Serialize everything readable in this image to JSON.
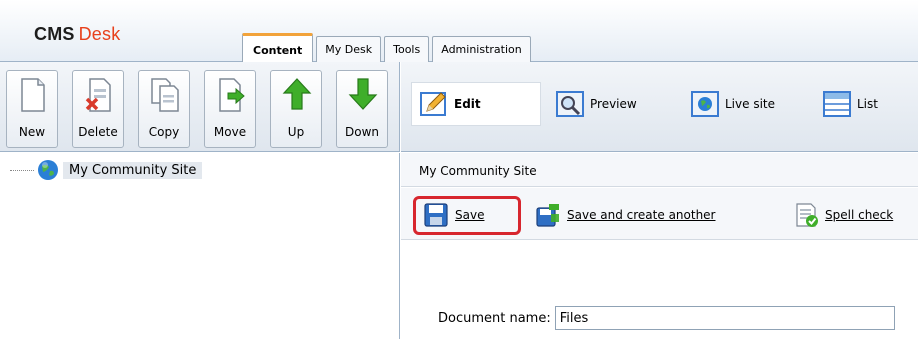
{
  "header": {
    "logo_brand": "CMS",
    "logo_product": "Desk",
    "tabs": [
      {
        "label": "Content",
        "active": true
      },
      {
        "label": "My Desk",
        "active": false
      },
      {
        "label": "Tools",
        "active": false
      },
      {
        "label": "Administration",
        "active": false
      }
    ]
  },
  "tree_toolbar": {
    "buttons": [
      {
        "label": "New",
        "icon": "new-document-icon"
      },
      {
        "label": "Delete",
        "icon": "delete-document-icon"
      },
      {
        "label": "Copy",
        "icon": "copy-document-icon"
      },
      {
        "label": "Move",
        "icon": "move-document-icon"
      },
      {
        "label": "Up",
        "icon": "up-arrow-icon"
      },
      {
        "label": "Down",
        "icon": "down-arrow-icon"
      }
    ]
  },
  "view_modes": [
    {
      "label": "Edit",
      "icon": "pencil-icon",
      "active": true
    },
    {
      "label": "Preview",
      "icon": "magnifier-icon",
      "active": false
    },
    {
      "label": "Live site",
      "icon": "globe-icon",
      "active": false
    },
    {
      "label": "List",
      "icon": "list-icon",
      "active": false
    }
  ],
  "tree": {
    "root_label": "My Community Site",
    "root_icon": "globe-icon"
  },
  "content": {
    "breadcrumb": "My Community Site",
    "actions": [
      {
        "label": "Save",
        "icon": "floppy-disk-icon",
        "highlighted": true
      },
      {
        "label": "Save and create another",
        "icon": "save-and-new-icon"
      },
      {
        "label": "Spell check",
        "icon": "spellcheck-icon"
      }
    ],
    "document_name_label": "Document name:",
    "document_name_value": "Files"
  },
  "colors": {
    "accent_orange": "#e8401c",
    "highlight_red": "#d7262e",
    "tab_active_border": "#f2a33a",
    "green_arrow": "#3fae2a"
  }
}
